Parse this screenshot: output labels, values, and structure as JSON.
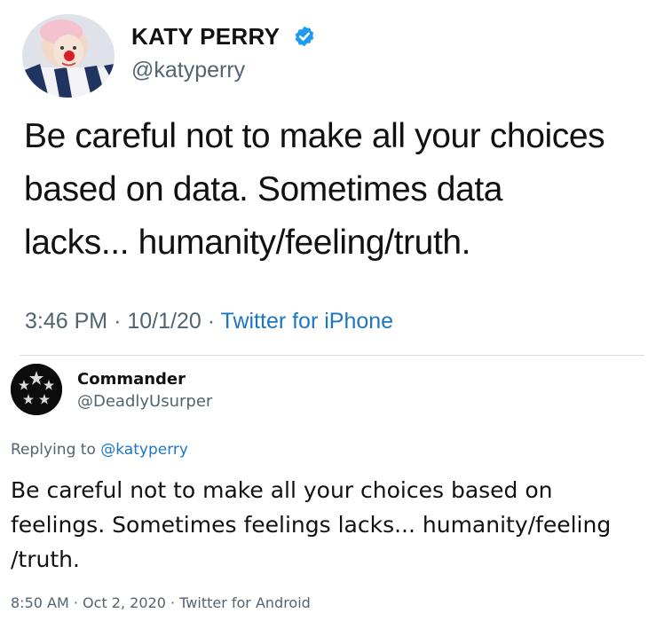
{
  "tweet": {
    "display_name": "KATY PERRY",
    "verified": true,
    "verified_icon": "verified-badge-icon",
    "handle": "@katyperry",
    "text_lines": [
      "Be careful not to make all your choices",
      "based on data. Sometimes data",
      "lacks... humanity/feeling/truth."
    ],
    "time": "3:46 PM",
    "date": "10/1/20",
    "separator": "·",
    "source": "Twitter for iPhone"
  },
  "reply": {
    "display_name": "Commander",
    "handle": "@DeadlyUsurper",
    "replying_prefix": "Replying to ",
    "replying_to": "@katyperry",
    "text_lines": [
      "Be careful not to make all your choices based on",
      "feelings. Sometimes feelings lacks... humanity/feeling",
      "/truth."
    ],
    "time": "8:50 AM",
    "date": "Oct 2, 2020",
    "separator": "·",
    "source": "Twitter for Android"
  },
  "colors": {
    "link_blue": "#1d76c4",
    "verified_blue": "#1d9bf0",
    "secondary_gray": "#536471",
    "text": "#111111",
    "divider": "#d6dde2"
  }
}
